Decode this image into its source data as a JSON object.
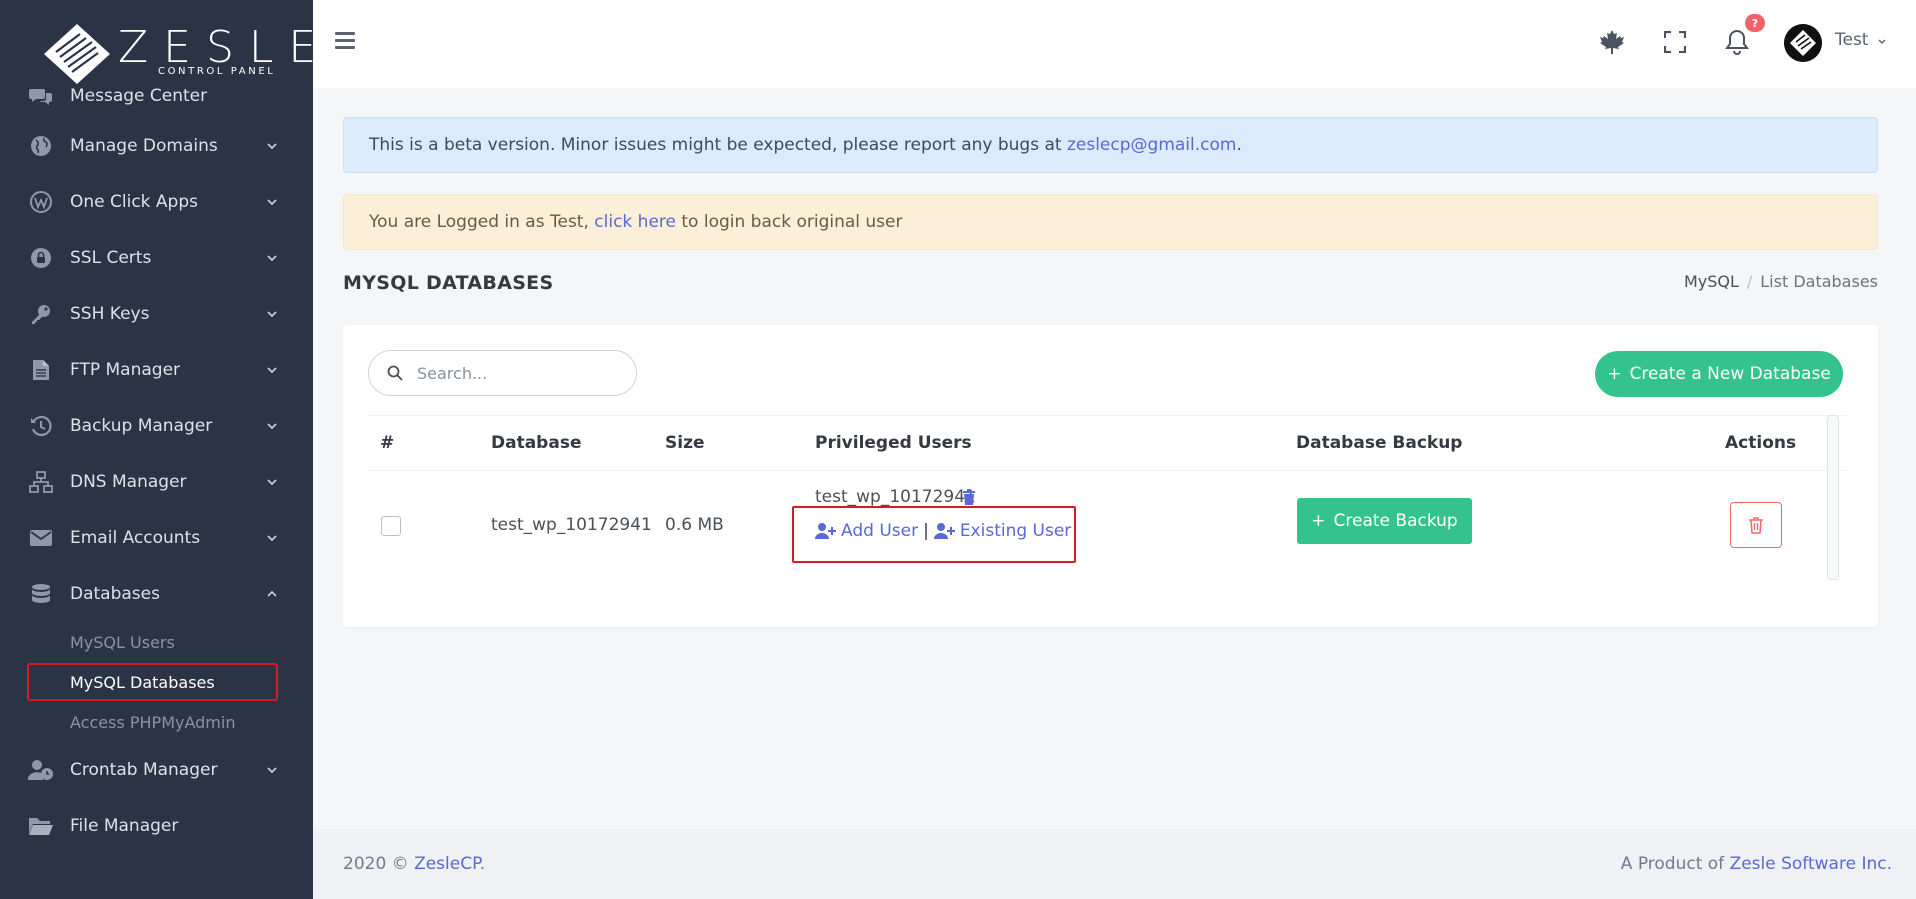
{
  "brand": {
    "name": "ZESLE",
    "tagline": "CONTROL PANEL"
  },
  "sidebar": {
    "items": [
      {
        "label": "Message Center",
        "icon": "chat-icon"
      },
      {
        "label": "Manage Domains",
        "icon": "globe-icon"
      },
      {
        "label": "One Click Apps",
        "icon": "wordpress-icon"
      },
      {
        "label": "SSL Certs",
        "icon": "lock-icon"
      },
      {
        "label": "SSH Keys",
        "icon": "key-icon"
      },
      {
        "label": "FTP Manager",
        "icon": "file-icon"
      },
      {
        "label": "Backup Manager",
        "icon": "history-icon"
      },
      {
        "label": "DNS Manager",
        "icon": "network-icon"
      },
      {
        "label": "Email Accounts",
        "icon": "envelope-icon"
      },
      {
        "label": "Databases",
        "icon": "database-icon"
      },
      {
        "label": "Crontab Manager",
        "icon": "user-clock-icon"
      },
      {
        "label": "File Manager",
        "icon": "folder-icon"
      }
    ],
    "database_sub": [
      "MySQL Users",
      "MySQL Databases",
      "Access PHPMyAdmin"
    ]
  },
  "topbar": {
    "notification_count": "?",
    "user_name": "Test"
  },
  "alerts": {
    "beta_text": "This is a beta version. Minor issues might be expected, please report any bugs at ",
    "beta_email": "zeslecp@gmail.com",
    "beta_end": ".",
    "login_text": "You are Logged in as Test, ",
    "login_link": "click here",
    "login_end": " to login back original user"
  },
  "page": {
    "title": "MYSQL DATABASES",
    "breadcrumb": [
      "MySQL",
      "List Databases"
    ]
  },
  "toolbar": {
    "search_placeholder": "Search...",
    "create_label": "Create a New Database"
  },
  "table": {
    "headers": [
      "#",
      "Database",
      "Size",
      "Privileged Users",
      "Database Backup",
      "Actions"
    ],
    "rows": [
      {
        "database": "test_wp_10172941",
        "size": "0.6 MB",
        "user": "test_wp_10172941",
        "add_user": "Add User",
        "existing_user": "Existing User",
        "backup_label": "Create Backup"
      }
    ]
  },
  "footer": {
    "left_prefix": "2020 © ",
    "left_link": "ZesleCP",
    "left_suffix": ".",
    "right_prefix": "A Product of ",
    "right_link": "Zesle Software Inc."
  },
  "colors": {
    "sidebar_bg": "#2b3447",
    "accent_green": "#34c38f",
    "link_blue": "#5868d6",
    "danger": "#f46a6a",
    "highlight_red": "#d41c22"
  }
}
